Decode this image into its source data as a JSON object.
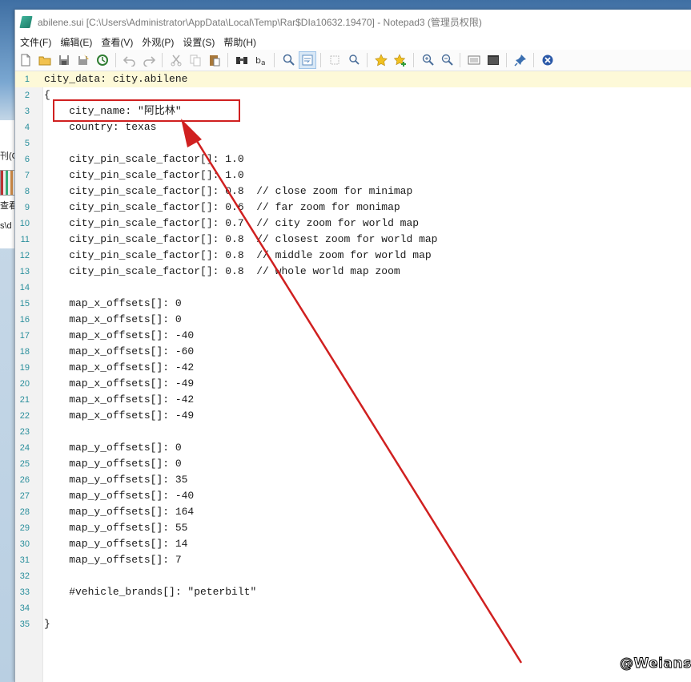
{
  "window": {
    "title": "abilene.sui [C:\\Users\\Administrator\\AppData\\Local\\Temp\\Rar$DIa10632.19470] - Notepad3  (管理员权限)"
  },
  "menu": [
    "文件(F)",
    "编辑(E)",
    "查看(V)",
    "外观(P)",
    "设置(S)",
    "帮助(H)"
  ],
  "toolbar": {
    "icons": [
      "new-file-icon",
      "open-folder-icon",
      "save-icon",
      "save-as-icon",
      "revert-icon",
      "undo-icon",
      "redo-icon",
      "cut-icon",
      "copy-icon",
      "paste-icon",
      "find-icon",
      "replace-icon",
      "goto-icon",
      "word-wrap-icon",
      "select-icon",
      "find-next-icon",
      "favorites-icon",
      "add-favorite-icon",
      "zoom-in-icon",
      "zoom-out-icon",
      "scheme-icon",
      "settings-icon",
      "pin-icon",
      "exit-icon"
    ]
  },
  "background_window": {
    "fragments": [
      "刊(Q",
      "查看",
      "s\\d"
    ]
  },
  "editor": {
    "current_line": 1,
    "lines": [
      {
        "n": "1",
        "text": "city_data: city.abilene"
      },
      {
        "n": "2",
        "text": "{"
      },
      {
        "n": "3",
        "text": "    city_name: \"阿比林\""
      },
      {
        "n": "4",
        "text": "    country: texas"
      },
      {
        "n": "5",
        "text": ""
      },
      {
        "n": "6",
        "text": "    city_pin_scale_factor[]: 1.0"
      },
      {
        "n": "7",
        "text": "    city_pin_scale_factor[]: 1.0"
      },
      {
        "n": "8",
        "text": "    city_pin_scale_factor[]: 0.8  // close zoom for minimap"
      },
      {
        "n": "9",
        "text": "    city_pin_scale_factor[]: 0.6  // far zoom for monimap"
      },
      {
        "n": "10",
        "text": "    city_pin_scale_factor[]: 0.7  // city zoom for world map"
      },
      {
        "n": "11",
        "text": "    city_pin_scale_factor[]: 0.8  // closest zoom for world map"
      },
      {
        "n": "12",
        "text": "    city_pin_scale_factor[]: 0.8  // middle zoom for world map"
      },
      {
        "n": "13",
        "text": "    city_pin_scale_factor[]: 0.8  // whole world map zoom"
      },
      {
        "n": "14",
        "text": ""
      },
      {
        "n": "15",
        "text": "    map_x_offsets[]: 0"
      },
      {
        "n": "16",
        "text": "    map_x_offsets[]: 0"
      },
      {
        "n": "17",
        "text": "    map_x_offsets[]: -40"
      },
      {
        "n": "18",
        "text": "    map_x_offsets[]: -60"
      },
      {
        "n": "19",
        "text": "    map_x_offsets[]: -42"
      },
      {
        "n": "20",
        "text": "    map_x_offsets[]: -49"
      },
      {
        "n": "21",
        "text": "    map_x_offsets[]: -42"
      },
      {
        "n": "22",
        "text": "    map_x_offsets[]: -49"
      },
      {
        "n": "23",
        "text": ""
      },
      {
        "n": "24",
        "text": "    map_y_offsets[]: 0"
      },
      {
        "n": "25",
        "text": "    map_y_offsets[]: 0"
      },
      {
        "n": "26",
        "text": "    map_y_offsets[]: 35"
      },
      {
        "n": "27",
        "text": "    map_y_offsets[]: -40"
      },
      {
        "n": "28",
        "text": "    map_y_offsets[]: 164"
      },
      {
        "n": "29",
        "text": "    map_y_offsets[]: 55"
      },
      {
        "n": "30",
        "text": "    map_y_offsets[]: 14"
      },
      {
        "n": "31",
        "text": "    map_y_offsets[]: 7"
      },
      {
        "n": "32",
        "text": ""
      },
      {
        "n": "33",
        "text": "    #vehicle_brands[]: \"peterbilt\""
      },
      {
        "n": "34",
        "text": ""
      },
      {
        "n": "35",
        "text": "}"
      }
    ]
  },
  "annotation": {
    "color": "#d02020"
  },
  "watermark": "@Weians"
}
